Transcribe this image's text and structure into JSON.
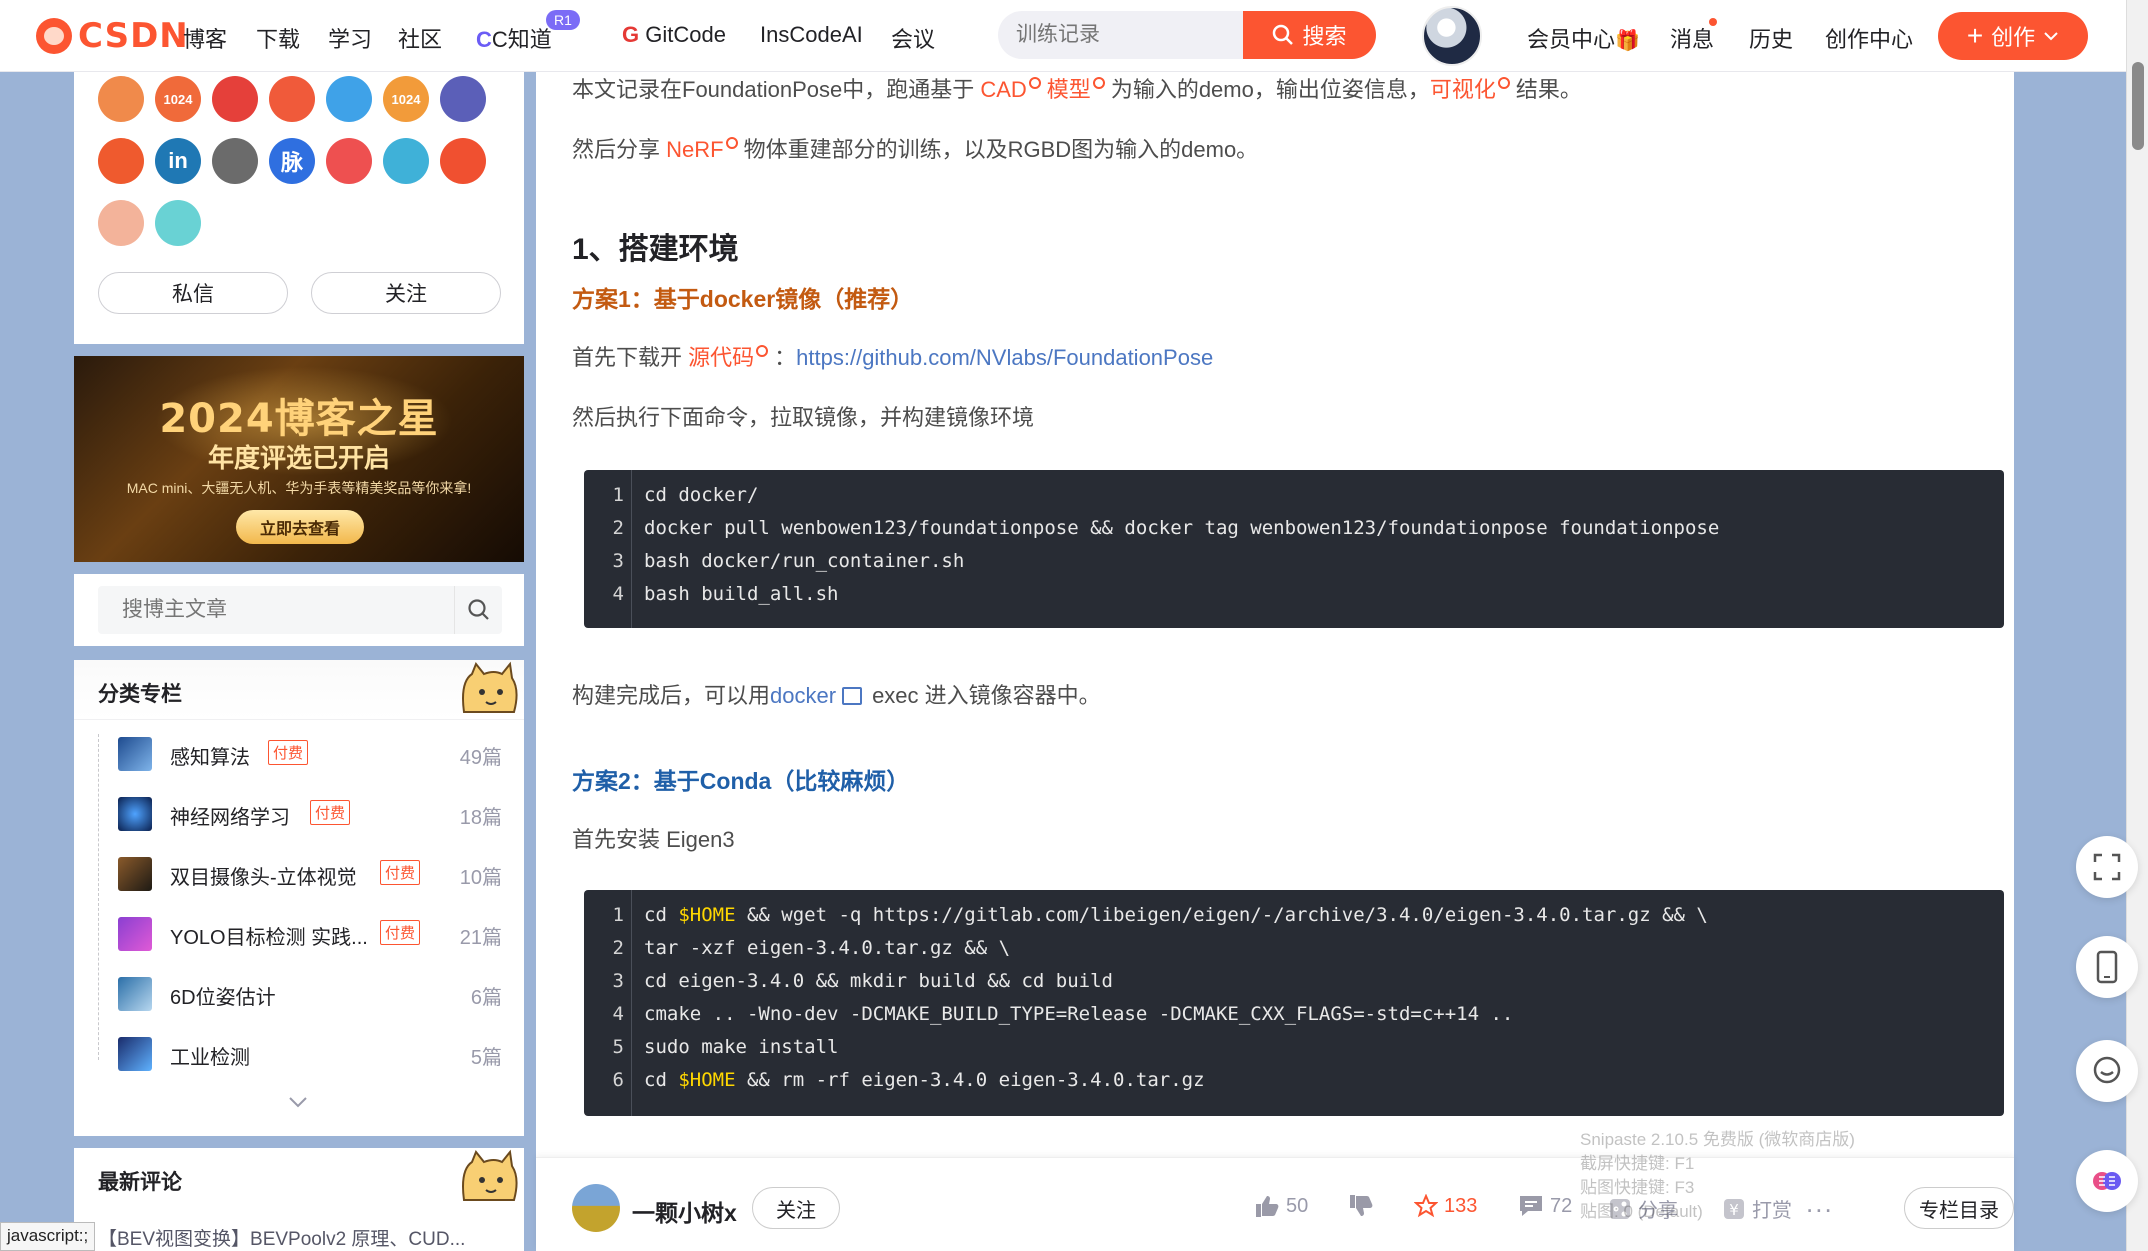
{
  "nav": {
    "logo_text": "CSDN",
    "items": [
      "博客",
      "下载",
      "学习",
      "社区",
      "C知道",
      "GitCode",
      "InsCodeAI",
      "会议"
    ],
    "cknow_badge": "R1",
    "search_placeholder": "训练记录",
    "search_button": "搜索",
    "right_items": [
      "会员中心",
      "消息",
      "历史",
      "创作中心"
    ],
    "create_button": "创作",
    "accent": "#fc5531"
  },
  "sidebar": {
    "badge_icons": [
      "csdn-icon",
      "1024-icon",
      "pen-icon",
      "monkey-icon",
      "star-icon",
      "1024-icon",
      "expert-icon",
      "fire-icon",
      "linkedin-icon",
      "github-icon",
      "maimai-icon",
      "medal-icon",
      "chat-icon",
      "rank-icon",
      "anniversary-icon",
      "bubble-icon"
    ],
    "badge_text": {
      "b1024a": "1024",
      "b1024b": "1024",
      "linkedin": "in",
      "maimai": "脉"
    },
    "message_button": "私信",
    "follow_button": "关注",
    "ad": {
      "title": "2024博客之星",
      "subtitle": "年度评选已开启",
      "line": "MAC mini、大疆无人机、华为手表等精美奖品等你来拿!",
      "button": "立即去查看"
    },
    "blog_search_placeholder": "搜博主文章",
    "categories_title": "分类专栏",
    "categories": [
      {
        "name": "感知算法",
        "paid": "付费",
        "count": "49篇"
      },
      {
        "name": "神经网络学习",
        "paid": "付费",
        "count": "18篇"
      },
      {
        "name": "双目摄像头-立体视觉",
        "paid": "付费",
        "count": "10篇"
      },
      {
        "name": "YOLO目标检测 实践...",
        "paid": "付费",
        "count": "21篇"
      },
      {
        "name": "6D位姿估计",
        "paid": "",
        "count": "6篇"
      },
      {
        "name": "工业检测",
        "paid": "",
        "count": "5篇"
      }
    ],
    "comments_title": "最新评论",
    "comment_preview": "【BEV视图变换】BEVPoolv2 原理、CUD...",
    "status_text": "javascript:;"
  },
  "article": {
    "p1": {
      "a": "本文记录在FoundationPose中，跑通基于 ",
      "k1": "CAD",
      "k2": "模型",
      "b": "为输入的demo，输出位姿信息，",
      "k3": "可视化",
      "c": "结果。"
    },
    "p2": {
      "a": "然后分享 ",
      "k1": "NeRF",
      "b": "物体重建部分的训练，以及RGBD图为输入的demo。"
    },
    "h_env": "1、搭建环境",
    "h_docker": "方案1：基于docker镜像（推荐）",
    "p3": {
      "a": "首先下载开 ",
      "k1": "源代码",
      "b": "：",
      "url": "https://github.com/NVlabs/FoundationPose"
    },
    "p4": "然后执行下面命令，拉取镜像，并构建镜像环境",
    "code1": [
      "cd docker/",
      "docker pull wenbowen123/foundationpose && docker tag wenbowen123/foundationpose foundationpose",
      "bash docker/run_container.sh",
      "bash build_all.sh"
    ],
    "p5": {
      "a": "构建完成后，可以用",
      "k1": "docker",
      "b": "exec 进入镜像容器中。"
    },
    "h_conda": "方案2：基于Conda（比较麻烦）",
    "p6": "首先安装 Eigen3",
    "code2": {
      "l1a": "cd ",
      "l1v": "$HOME",
      "l1b": " && wget -q https://gitlab.com/libeigen/eigen/-/archive/3.4.0/eigen-3.4.0.tar.gz && \\",
      "l2": "tar -xzf eigen-3.4.0.tar.gz && \\",
      "l3": "cd eigen-3.4.0 && mkdir build && cd build",
      "l4": "cmake .. -Wno-dev -DCMAKE_BUILD_TYPE=Release -DCMAKE_CXX_FLAGS=-std=c++14 ..",
      "l5": "sudo make install",
      "l6a": "cd ",
      "l6v": "$HOME",
      "l6b": " && rm -rf eigen-3.4.0 eigen-3.4.0.tar.gz"
    },
    "line_numbers": [
      "1",
      "2",
      "3",
      "4",
      "5",
      "6"
    ]
  },
  "toolbar": {
    "author": "一颗小树x",
    "follow": "关注",
    "likes": "50",
    "stars": "133",
    "comments": "72",
    "reward": "打赏",
    "share": "分享",
    "more": "...",
    "column_catalog": "专栏目录"
  },
  "snipaste": [
    "Snipaste 2.10.5 免费版 (微软商店版)",
    "截屏快捷键: F1",
    "贴图快捷键: F3",
    "贴图: 0 (Default)"
  ]
}
